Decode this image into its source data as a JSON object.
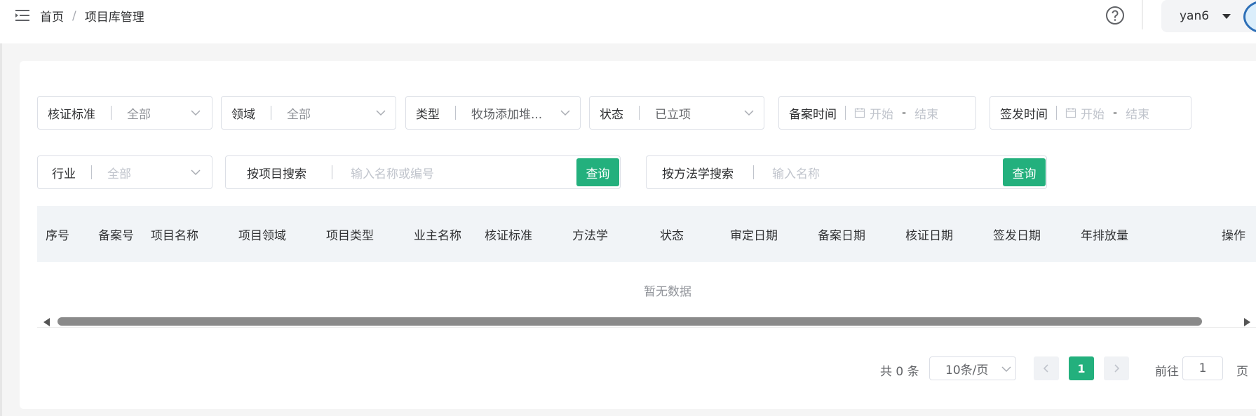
{
  "header": {
    "breadcrumb": {
      "home": "首页",
      "separator": "/",
      "current": "项目库管理"
    },
    "username": "yan6"
  },
  "filters": {
    "standard": {
      "label": "核证标准",
      "value": "全部"
    },
    "domain": {
      "label": "领域",
      "value": "全部"
    },
    "type": {
      "label": "类型",
      "value": "牧场添加堆..."
    },
    "status": {
      "label": "状态",
      "value": "已立项"
    },
    "filing_time": {
      "label": "备案时间",
      "start_placeholder": "开始",
      "end_placeholder": "结束",
      "dash": "-"
    },
    "issue_time": {
      "label": "签发时间",
      "start_placeholder": "开始",
      "end_placeholder": "结束",
      "dash": "-"
    },
    "industry": {
      "label": "行业",
      "value": "全部"
    },
    "project_search": {
      "label": "按项目搜索",
      "placeholder": "输入名称或编号",
      "button": "查询"
    },
    "method_search": {
      "label": "按方法学搜索",
      "placeholder": "输入名称",
      "button": "查询"
    }
  },
  "table": {
    "columns": [
      "序号",
      "备案号",
      "项目名称",
      "项目领域",
      "项目类型",
      "业主名称",
      "核证标准",
      "方法学",
      "状态",
      "审定日期",
      "备案日期",
      "核证日期",
      "签发日期",
      "年排放量",
      "操作"
    ],
    "empty_text": "暂无数据"
  },
  "pagination": {
    "total_text": "共 0 条",
    "page_size": "10条/页",
    "current_page": "1",
    "goto_label": "前往",
    "goto_value": "1",
    "page_suffix": "页"
  },
  "colors": {
    "primary": "#23b07d",
    "header_bg": "#f1f4f7"
  }
}
